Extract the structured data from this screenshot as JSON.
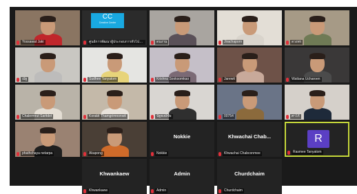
{
  "meeting": {
    "tiles": [
      {
        "name": "Yossawat Jaki",
        "label": "",
        "avatar_letter": "",
        "logo": "",
        "logo_sub": "",
        "active": false,
        "bg": "#8a7562",
        "shirt": "#c0262b",
        "video": true
      },
      {
        "name": "ศูนย์การพัฒนาผู้ประกอบการทั่วไปและโซเชียล",
        "label": "",
        "avatar_letter": "",
        "logo": "CC",
        "logo_sub": "Creative Center",
        "active": false,
        "bg": "#2b2b2b",
        "shirt": "",
        "video": false
      },
      {
        "name": "ดนงาน",
        "label": "",
        "avatar_letter": "",
        "logo": "",
        "logo_sub": "",
        "active": false,
        "bg": "#a9a5a0",
        "shirt": "#5a5058",
        "video": true
      },
      {
        "name": "Jirachaporn",
        "label": "",
        "avatar_letter": "",
        "logo": "",
        "logo_sub": "",
        "active": false,
        "bg": "#e3ded6",
        "shirt": "#d9d4cc",
        "video": true
      },
      {
        "name": "ดวงพร",
        "label": "",
        "avatar_letter": "",
        "logo": "",
        "logo_sub": "",
        "active": false,
        "bg": "#a69a86",
        "shirt": "#6f7a55",
        "video": true
      },
      {
        "name": "ณัฐ",
        "label": "",
        "avatar_letter": "",
        "logo": "",
        "logo_sub": "",
        "active": false,
        "bg": "#c9c7c2",
        "shirt": "#bdbcbb",
        "video": true
      },
      {
        "name": "Sudhee Tanyatom",
        "label": "",
        "avatar_letter": "",
        "logo": "",
        "logo_sub": "",
        "active": false,
        "bg": "#e5e5e2",
        "shirt": "#e7d47a",
        "video": true
      },
      {
        "name": "Krishna Sooksomkao",
        "label": "",
        "avatar_letter": "",
        "logo": "",
        "logo_sub": "",
        "active": false,
        "bg": "#c5bfc8",
        "shirt": "#7b6a75",
        "video": true
      },
      {
        "name": "Jarewit",
        "label": "",
        "avatar_letter": "",
        "logo": "",
        "logo_sub": "",
        "active": false,
        "bg": "#6e5248",
        "shirt": "#c8a99a",
        "video": true
      },
      {
        "name": "Wattana Ucharoen",
        "label": "",
        "avatar_letter": "",
        "logo": "",
        "logo_sub": "",
        "active": false,
        "bg": "#3a3838",
        "shirt": "#4b4b4b",
        "video": true
      },
      {
        "name": "Chalermrut Saritdet",
        "label": "",
        "avatar_letter": "",
        "logo": "",
        "logo_sub": "",
        "active": false,
        "bg": "#b9b3a8",
        "shirt": "#e3ddd3",
        "video": true
      },
      {
        "name": "Korakit Thamgrimnonwit",
        "label": "",
        "avatar_letter": "",
        "logo": "",
        "logo_sub": "",
        "active": false,
        "bg": "#c4b9a9",
        "shirt": "#e8e2da",
        "video": true
      },
      {
        "name": "นัฐพงษ์ชัย",
        "label": "",
        "avatar_letter": "",
        "logo": "",
        "logo_sub": "",
        "active": false,
        "bg": "#d9d6d2",
        "shirt": "#2f2f2f",
        "video": true
      },
      {
        "name": "00754",
        "label": "",
        "avatar_letter": "",
        "logo": "",
        "logo_sub": "",
        "active": false,
        "bg": "#6a7487",
        "shirt": "#8b6a3c",
        "video": true
      },
      {
        "name": "ศาโก้",
        "label": "",
        "avatar_letter": "",
        "logo": "",
        "logo_sub": "",
        "active": false,
        "bg": "#d5d0ca",
        "shirt": "#1e2a3a",
        "video": true
      },
      {
        "name": "phathchaya netarpa",
        "label": "",
        "avatar_letter": "",
        "logo": "",
        "logo_sub": "",
        "active": false,
        "bg": "#9a8272",
        "shirt": "#1f1f1f",
        "video": true
      },
      {
        "name": "Akapong",
        "label": "",
        "avatar_letter": "",
        "logo": "",
        "logo_sub": "",
        "active": false,
        "bg": "#4a3f36",
        "shirt": "#cf6b2a",
        "video": true
      },
      {
        "name": "Nokkie",
        "label": "Nokkie",
        "avatar_letter": "",
        "logo": "",
        "logo_sub": "",
        "active": false,
        "bg": "#232323",
        "shirt": "",
        "video": false
      },
      {
        "name": "Khwachai Chabconmee",
        "label": "Khwachai Chab...",
        "avatar_letter": "",
        "logo": "",
        "logo_sub": "",
        "active": false,
        "bg": "#232323",
        "shirt": "",
        "video": false
      },
      {
        "name": "Rasmee Tanyatom",
        "label": "",
        "avatar_letter": "R",
        "logo": "",
        "logo_sub": "",
        "active": true,
        "bg": "#232323",
        "shirt": "",
        "video": false
      },
      {
        "name": "Khwankaew",
        "label": "Khwankaew",
        "avatar_letter": "",
        "logo": "",
        "logo_sub": "",
        "active": false,
        "bg": "#232323",
        "shirt": "",
        "video": false
      },
      {
        "name": "Admin",
        "label": "Admin",
        "avatar_letter": "",
        "logo": "",
        "logo_sub": "",
        "active": false,
        "bg": "#232323",
        "shirt": "",
        "video": false
      },
      {
        "name": "Churdchaim",
        "label": "Churdchaim",
        "avatar_letter": "",
        "logo": "",
        "logo_sub": "",
        "active": false,
        "bg": "#232323",
        "shirt": "",
        "video": false
      }
    ],
    "colors": {
      "grid_bg": "#1a1a1a",
      "tile_bg": "#232323",
      "active_border": "#c7d93a",
      "mute_icon": "#e0303a",
      "avatar_bg": "#5b3fc4",
      "logo_bg": "#19a9e1"
    }
  }
}
